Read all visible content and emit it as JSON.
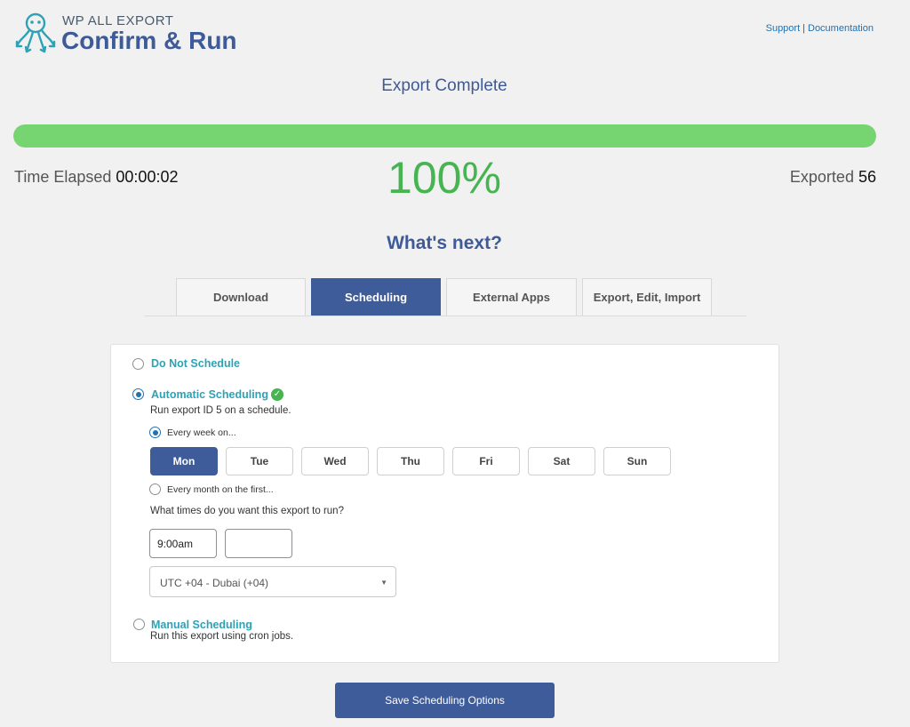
{
  "header": {
    "brand_small": "WP ALL EXPORT",
    "brand_title": "Confirm & Run",
    "links": [
      {
        "label": "Support"
      },
      {
        "label": "Documentation"
      }
    ],
    "link_separator": "|"
  },
  "export": {
    "status": "Export Complete",
    "progress": 1.0,
    "percent_text": "100%",
    "time_elapsed_label": "Time Elapsed",
    "time_elapsed_value": "00:00:02",
    "exported_label": "Exported",
    "exported_value": "56",
    "progress_color": "#76d571"
  },
  "whats_next": "What's next?",
  "tabs": [
    {
      "label": "Download",
      "active": false
    },
    {
      "label": "Scheduling",
      "active": true
    },
    {
      "label": "External Apps",
      "active": false
    },
    {
      "label": "Export, Edit, Import",
      "active": false
    }
  ],
  "scheduling": {
    "do_not_schedule": "Do Not Schedule",
    "automatic": {
      "title": "Automatic Scheduling",
      "description": "Run export ID 5 on a schedule.",
      "every_week": "Every week on...",
      "days": [
        "Mon",
        "Tue",
        "Wed",
        "Thu",
        "Fri",
        "Sat",
        "Sun"
      ],
      "selected_day": "Mon",
      "every_month": "Every month on the first...",
      "times_question": "What times do you want this export to run?",
      "times": [
        "9:00am",
        ""
      ],
      "timezone": "UTC +04 - Dubai (+04)"
    },
    "manual": {
      "title": "Manual Scheduling",
      "description": "Run this export using cron jobs."
    },
    "selected_option": "automatic"
  },
  "save_button": "Save Scheduling Options",
  "colors": {
    "brand_blue": "#3e5a98",
    "accent_teal": "#2ea2b5",
    "success_green": "#46b450"
  }
}
